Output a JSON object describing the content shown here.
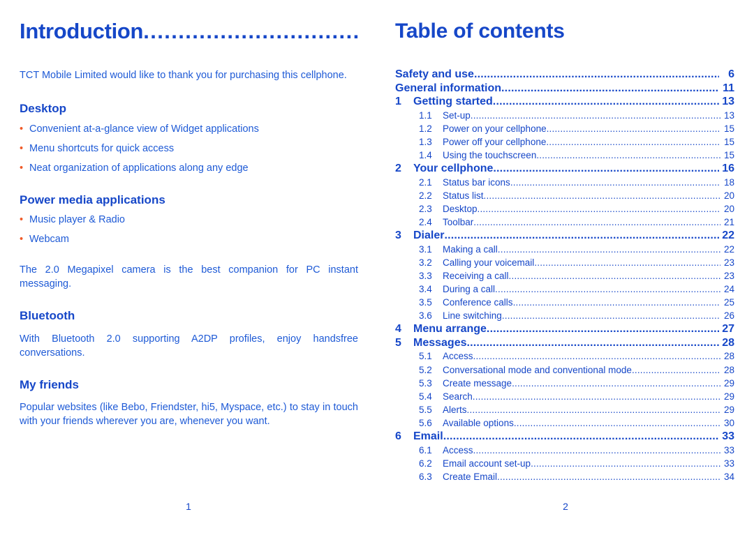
{
  "left_page": {
    "title": "Introduction",
    "title_leader": "...................................",
    "intro_paragraph": "TCT Mobile Limited would like to thank you for purchasing this cellphone.",
    "sections": [
      {
        "heading": "Desktop",
        "bullets": [
          "Convenient at-a-glance view of Widget applications",
          "Menu shortcuts for quick access",
          "Neat organization of applications along any edge"
        ]
      },
      {
        "heading": "Power media applications",
        "bullets": [
          "Music player & Radio",
          "Webcam"
        ]
      }
    ],
    "camera_paragraph": "The 2.0 Megapixel camera is the best companion for PC instant messaging.",
    "bluetooth_heading": "Bluetooth",
    "bluetooth_paragraph": "With Bluetooth 2.0 supporting A2DP profiles, enjoy handsfree conversations.",
    "friends_heading": "My friends",
    "friends_paragraph": "Popular websites (like Bebo, Friendster, hi5, Myspace, etc.) to stay in touch with your friends wherever you are, whenever you want.",
    "bullet_glyph": "•",
    "folio": "1"
  },
  "right_page": {
    "title": "Table of contents",
    "folio": "2",
    "entries": [
      {
        "level": 0,
        "num": "",
        "label": "Safety and use",
        "page": "6"
      },
      {
        "level": 0,
        "num": "",
        "label": "General information ",
        "page": "11"
      },
      {
        "level": 1,
        "num": "1",
        "label": "Getting started",
        "page": "13"
      },
      {
        "level": 2,
        "num": "1.1",
        "label": "Set-up ",
        "page": "13"
      },
      {
        "level": 2,
        "num": "1.2",
        "label": "Power on your cellphone",
        "page": "15"
      },
      {
        "level": 2,
        "num": "1.3",
        "label": "Power off your cellphone",
        "page": "15"
      },
      {
        "level": 2,
        "num": "1.4",
        "label": "Using the touchscreen ",
        "page": "15"
      },
      {
        "level": 1,
        "num": "2",
        "label": "Your cellphone ",
        "page": "16"
      },
      {
        "level": 2,
        "num": "2.1",
        "label": "Status bar icons",
        "page": "18"
      },
      {
        "level": 2,
        "num": "2.2",
        "label": "Status list ",
        "page": "20"
      },
      {
        "level": 2,
        "num": "2.3",
        "label": "Desktop ",
        "page": "20"
      },
      {
        "level": 2,
        "num": "2.4",
        "label": "Toolbar ",
        "page": "21"
      },
      {
        "level": 1,
        "num": "3",
        "label": "Dialer",
        "page": "22"
      },
      {
        "level": 2,
        "num": "3.1",
        "label": "Making a call",
        "page": "22"
      },
      {
        "level": 2,
        "num": "3.2",
        "label": "Calling your voicemail ",
        "page": "23"
      },
      {
        "level": 2,
        "num": "3.3",
        "label": "Receiving a call",
        "page": "23"
      },
      {
        "level": 2,
        "num": "3.4",
        "label": "During a call  ",
        "page": "24"
      },
      {
        "level": 2,
        "num": "3.5",
        "label": "Conference calls ",
        "page": "25"
      },
      {
        "level": 2,
        "num": "3.6",
        "label": "Line switching",
        "page": "26"
      },
      {
        "level": 1,
        "num": "4",
        "label": "Menu arrange ",
        "page": "27"
      },
      {
        "level": 1,
        "num": "5",
        "label": "Messages ",
        "page": "28"
      },
      {
        "level": 2,
        "num": "5.1",
        "label": "Access ",
        "page": "28"
      },
      {
        "level": 2,
        "num": "5.2",
        "label": "Conversational mode and conventional mode ",
        "page": "28"
      },
      {
        "level": 2,
        "num": "5.3",
        "label": "Create message",
        "page": "29"
      },
      {
        "level": 2,
        "num": "5.4",
        "label": "Search",
        "page": "29"
      },
      {
        "level": 2,
        "num": "5.5",
        "label": "Alerts",
        "page": "29"
      },
      {
        "level": 2,
        "num": "5.6",
        "label": "Available options",
        "page": "30"
      },
      {
        "level": 1,
        "num": "6",
        "label": "Email",
        "page": "33"
      },
      {
        "level": 2,
        "num": "6.1",
        "label": "Access ",
        "page": "33"
      },
      {
        "level": 2,
        "num": "6.2",
        "label": "Email account set-up",
        "page": "33"
      },
      {
        "level": 2,
        "num": "6.3",
        "label": "Create Email ",
        "page": "34"
      }
    ]
  },
  "colors": {
    "heading_blue": "#1647c8",
    "body_blue": "#1e5ad6",
    "bullet_orange": "#f05a28",
    "background": "#ffffff"
  }
}
